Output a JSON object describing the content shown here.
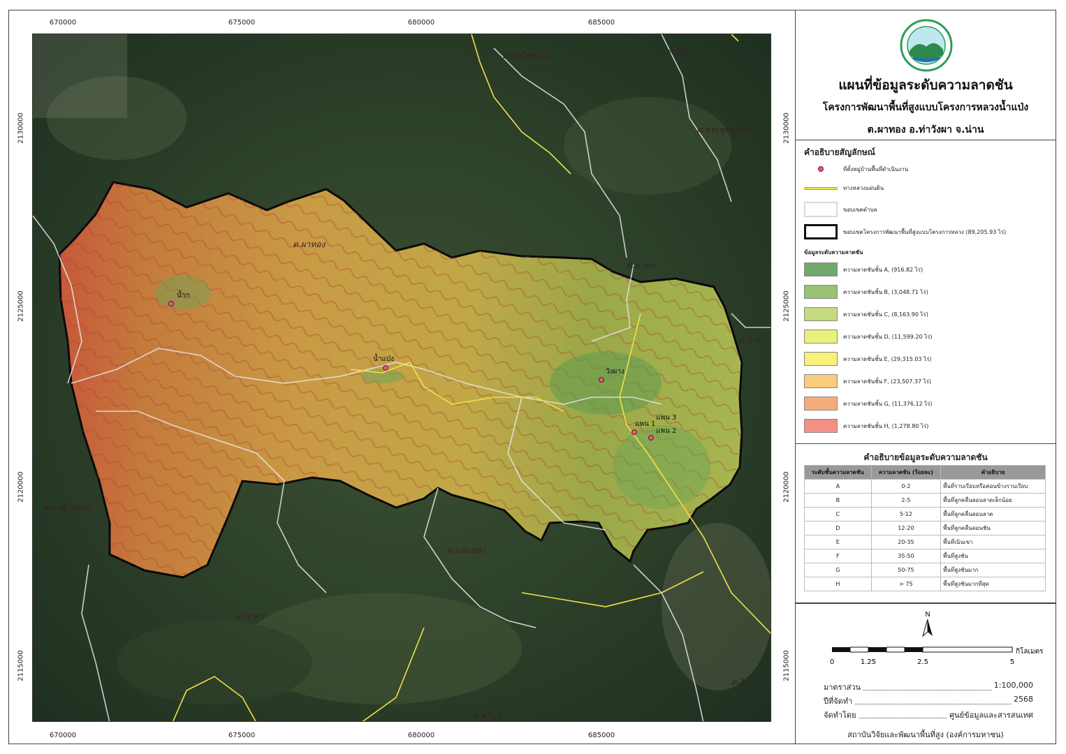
{
  "map": {
    "x_ticks": [
      "670000",
      "675000",
      "680000",
      "685000"
    ],
    "y_ticks": [
      "2130000",
      "2125000",
      "2120000",
      "2115000"
    ],
    "places": [
      {
        "name": "ต.นาไร่หลวง"
      },
      {
        "name": "ต.เปือ"
      },
      {
        "name": "ต.พระพุทธบาท"
      },
      {
        "name": "ต.ผาทอง"
      },
      {
        "name": "ต.ผาตอ"
      },
      {
        "name": "ต.แงง"
      },
      {
        "name": "ต.ผาช้างน้อย"
      },
      {
        "name": "ต.แสนทอง"
      },
      {
        "name": "ต.ป่าคา"
      },
      {
        "name": "ต.ริม"
      },
      {
        "name": "ต.ศรีภูมิ"
      }
    ],
    "villages": [
      {
        "name": "น้ำก"
      },
      {
        "name": "น้ำแป่ง"
      },
      {
        "name": "วังผาง"
      },
      {
        "name": "แพน 3"
      },
      {
        "name": "แพน 1"
      },
      {
        "name": "แพน 2"
      }
    ]
  },
  "header": {
    "title": "แผนที่ข้อมูลระดับความลาดชัน",
    "subtitle1": "โครงการพัฒนาพื้นที่สูงแบบโครงการหลวงน้ำแป่ง",
    "subtitle2": "ต.ผาทอง อ.ท่าวังผา จ.น่าน"
  },
  "legend": {
    "title": "คำอธิบายสัญลักษณ์",
    "symbols": [
      {
        "label": "ที่ตั้งหมู่บ้านพื้นที่ดำเนินงาน"
      },
      {
        "label": "ทางหลวงแผ่นดิน"
      },
      {
        "label": "ขอบเขตตำบล"
      },
      {
        "label": "ขอบเขตโครงการพัฒนาพื้นที่สูงแบบโครงการหลวง (89,205.93 ไร่)"
      }
    ],
    "slope_heading": "ข้อมูลระดับความลาดชัน",
    "classes": [
      {
        "label": "ความลาดชันชั้น A, (916.82 ไร่)",
        "color": "#6fa86a"
      },
      {
        "label": "ความลาดชันชั้น B, (3,048.71 ไร่)",
        "color": "#98c171"
      },
      {
        "label": "ความลาดชันชั้น C, (8,163.90 ไร่)",
        "color": "#c4db7f"
      },
      {
        "label": "ความลาดชันชั้น D, (11,599.20 ไร่)",
        "color": "#eaf07c"
      },
      {
        "label": "ความลาดชันชั้น E, (29,315.03 ไร่)",
        "color": "#faf07c"
      },
      {
        "label": "ความลาดชันชั้น F, (23,507.37 ไร่)",
        "color": "#f8cc7a"
      },
      {
        "label": "ความลาดชันชั้น G, (11,376.12 ไร่)",
        "color": "#f6ac7a"
      },
      {
        "label": "ความลาดชันชั้น H, (1,278.80 ไร่)",
        "color": "#f58f85"
      }
    ]
  },
  "slope_table": {
    "title": "คำอธิบายข้อมูลระดับความลาดชัน",
    "headers": [
      "ระดับชั้นความลาดชัน",
      "ความลาดชัน (ร้อยละ)",
      "คำอธิบาย"
    ],
    "rows": [
      [
        "A",
        "0-2",
        "พื้นที่ราบเรียบหรือค่อนข้างราบเรียบ"
      ],
      [
        "B",
        "2-5",
        "พื้นที่ลูกคลื่นลอนลาดเล็กน้อย"
      ],
      [
        "C",
        "5-12",
        "พื้นที่ลูกคลื่นลอนลาด"
      ],
      [
        "D",
        "12-20",
        "พื้นที่ลูกคลื่นลอนชัน"
      ],
      [
        "E",
        "20-35",
        "พื้นที่เนินเขา"
      ],
      [
        "F",
        "35-50",
        "พื้นที่สูงชัน"
      ],
      [
        "G",
        "50-75",
        "พื้นที่สูงชันมาก"
      ],
      [
        "H",
        "> 75",
        "พื้นที่สูงชันมากที่สุด"
      ]
    ]
  },
  "scalebar": {
    "north": "N",
    "labels": [
      "0",
      "1.25",
      "2.5",
      "5"
    ],
    "unit": "กิโลเมตร"
  },
  "meta": {
    "scale_label": "มาตราส่วน",
    "scale_value": "1:100,000",
    "year_label": "ปีที่จัดทำ",
    "year_value": "2568",
    "by_label": "จัดทำโดย",
    "by_value": "ศูนย์ข้อมูลและสารสนเทศ",
    "institute": "สถาบันวิจัยและพัฒนาพื้นที่สูง (องค์การมหาชน)"
  }
}
